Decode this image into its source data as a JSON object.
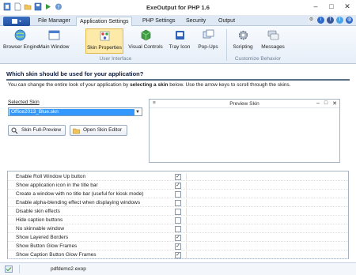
{
  "window": {
    "title": "ExeOutput for PHP 1.6"
  },
  "tabs": [
    {
      "label": "File Manager",
      "active": false
    },
    {
      "label": "Application Settings",
      "active": true
    },
    {
      "label": "PHP Settings",
      "active": false
    },
    {
      "label": "Security",
      "active": false
    },
    {
      "label": "Output",
      "active": false
    }
  ],
  "ribbon": {
    "buttons": [
      {
        "label": "Browser Engine",
        "icon": "globe-icon"
      },
      {
        "label": "Main Window",
        "icon": "window-icon"
      },
      {
        "label": "Skin Properties",
        "icon": "palette-icon",
        "active": true
      },
      {
        "label": "Visual Controls",
        "icon": "cube-icon"
      },
      {
        "label": "Tray Icon",
        "icon": "tray-icon"
      },
      {
        "label": "Pop-Ups",
        "icon": "popups-icon"
      },
      {
        "label": "Scripting",
        "icon": "gear-icon"
      },
      {
        "label": "Messages",
        "icon": "messages-icon"
      }
    ],
    "groups": [
      "User Interface",
      "Customize Behavior"
    ]
  },
  "content": {
    "question": "Which skin should be used for your application?",
    "description_pre": "You can change the entire look of your application by ",
    "description_bold": "selecting a skin",
    "description_post": " below. Use the arrow keys to scroll through the skins.",
    "selected_skin_label": "Selected Skin",
    "selected_skin_value": "Office2013_Blue.skn",
    "skin_full_preview_button": "Skin Full-Preview",
    "open_skin_editor_button": "Open Skin Editor",
    "preview_title": "Preview Skin"
  },
  "options": [
    {
      "label": "Enable Roll Window Up button",
      "checked": true
    },
    {
      "label": "Show application icon in the title bar",
      "checked": true
    },
    {
      "label": "Create a window with no title bar (useful for kiosk mode)",
      "checked": false
    },
    {
      "label": "Enable alpha-blending effect when displaying windows",
      "checked": false
    },
    {
      "label": "Disable skin effects",
      "checked": false
    },
    {
      "label": "Hide caption buttons",
      "checked": false
    },
    {
      "label": "No skinnable window",
      "checked": false
    },
    {
      "label": "Show Layered Borders",
      "checked": true
    },
    {
      "label": "Show Button Glow Frames",
      "checked": true
    },
    {
      "label": "Show Caption Button Glow Frames",
      "checked": true
    }
  ],
  "status": {
    "filename": "pdfdemo2.exop"
  },
  "colors": {
    "accent": "#1f4f9e",
    "ribbon_active": "#fde9a8",
    "selection": "#3399ff"
  }
}
